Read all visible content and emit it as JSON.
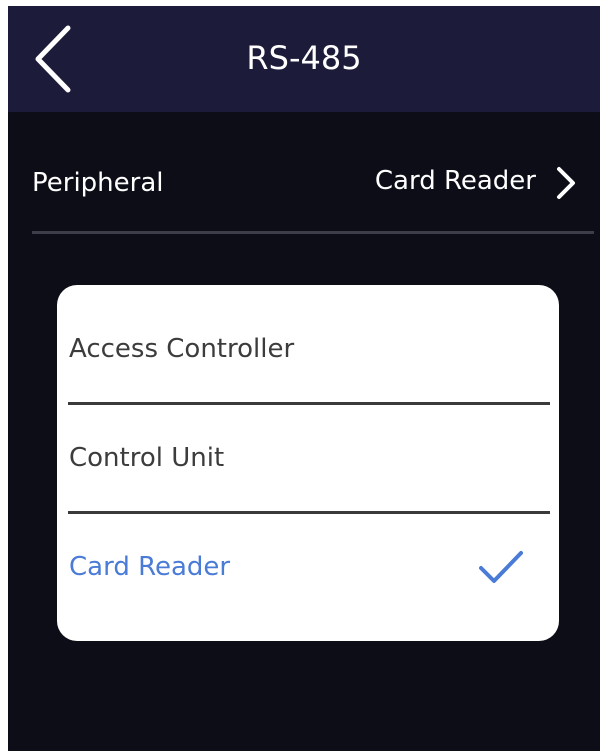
{
  "header": {
    "title": "RS-485"
  },
  "peripheral": {
    "label": "Peripheral",
    "value": "Card Reader"
  },
  "dialog": {
    "options": [
      {
        "label": "Access Controller",
        "selected": false
      },
      {
        "label": "Control Unit",
        "selected": false
      },
      {
        "label": "Card Reader",
        "selected": true
      }
    ]
  },
  "icons": {
    "back": "back-chevron-icon",
    "peripheral_arrow": "chevron-right-icon",
    "selected_mark": "check-icon"
  },
  "colors": {
    "header_bg": "#1c1c3a",
    "screen_bg": "#0d0d18",
    "dialog_bg": "#ffffff",
    "selected_text": "#4a7bd6",
    "option_text": "#3c3c3c"
  }
}
